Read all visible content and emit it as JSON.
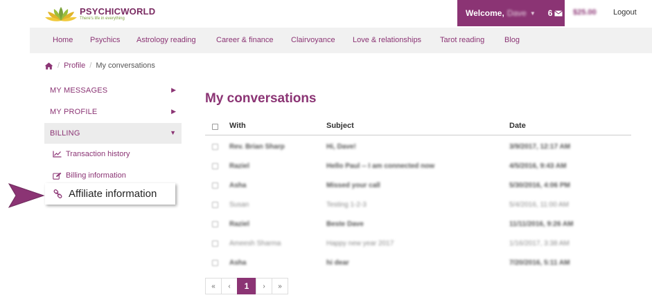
{
  "header": {
    "brand": "PSYCHICWORLD",
    "tagline": "There's life in everything",
    "welcome_label": "Welcome,",
    "welcome_name": "Dave",
    "message_count": "6",
    "balance": "$25.00",
    "logout_label": "Logout",
    "colors": {
      "brand": "#8b3474",
      "accent": "#7aa23a",
      "nav_bg": "#f1f1f1"
    }
  },
  "nav": {
    "items": [
      "Home",
      "Psychics",
      "Astrology reading",
      "Career & finance",
      "Clairvoyance",
      "Love & relationships",
      "Tarot reading",
      "Blog"
    ]
  },
  "breadcrumb": {
    "home_icon": "home-icon",
    "profile": "Profile",
    "current": "My conversations"
  },
  "sidebar": {
    "items": [
      {
        "label": "MY MESSAGES",
        "arrow": "▶"
      },
      {
        "label": "MY PROFILE",
        "arrow": "▶"
      },
      {
        "label": "BILLING",
        "arrow": "▼"
      }
    ],
    "sub_items": [
      {
        "label": "Transaction history",
        "icon": "line-chart-icon"
      },
      {
        "label": "Billing information",
        "icon": "edit-icon"
      }
    ],
    "callout": {
      "label": "Affiliate information",
      "icon": "link-icon"
    }
  },
  "main": {
    "title": "My conversations",
    "columns": {
      "with": "With",
      "subject": "Subject",
      "date": "Date"
    },
    "rows": [
      {
        "with": "Rev. Brian Sharp",
        "subject": "Hi, Dave!",
        "date": "3/9/2017, 12:17 AM",
        "read": false
      },
      {
        "with": "Raziel",
        "subject": "Hello Paul -- I am connected now",
        "date": "4/5/2016, 9:43 AM",
        "read": false
      },
      {
        "with": "Asha",
        "subject": "Missed your call",
        "date": "5/30/2016, 4:06 PM",
        "read": false
      },
      {
        "with": "Susan",
        "subject": "Testing 1-2-3",
        "date": "5/4/2016, 11:00 AM",
        "read": true
      },
      {
        "with": "Raziel",
        "subject": "Beste Dave",
        "date": "11/11/2016, 9:26 AM",
        "read": false
      },
      {
        "with": "Ameesh Sharma",
        "subject": "Happy new year 2017",
        "date": "1/16/2017, 3:38 AM",
        "read": true
      },
      {
        "with": "Asha",
        "subject": "hi dear",
        "date": "7/20/2016, 5:11 AM",
        "read": false
      }
    ]
  },
  "pagination": {
    "first": "«",
    "prev": "‹",
    "current": "1",
    "next": "›",
    "last": "»"
  }
}
